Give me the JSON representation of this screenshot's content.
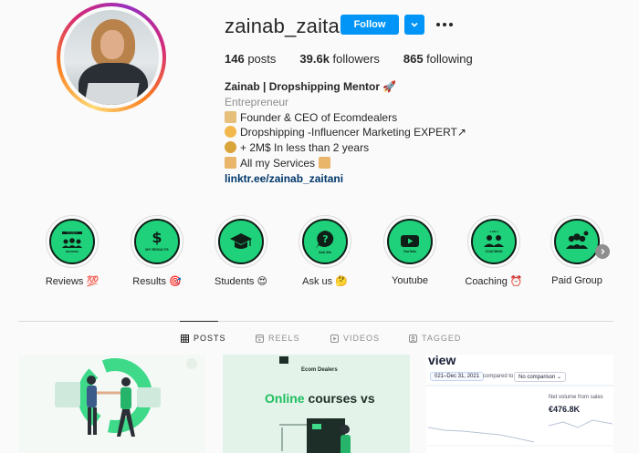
{
  "profile": {
    "username": "zainab_zaitani",
    "follow_label": "Follow",
    "stats": {
      "posts_count": "146",
      "posts_label": " posts",
      "followers_count": "39.6k",
      "followers_label": " followers",
      "following_count": "865",
      "following_label": " following"
    },
    "bio": {
      "name": "Zainab | Dropshipping Mentor 🚀",
      "category": "Entrepreneur",
      "lines": [
        "Founder & CEO of Ecomdealers",
        "Dropshipping -Influencer Marketing EXPERT↗",
        "+ 2M$ In less than 2 years",
        "All my Services"
      ],
      "link": "linktr.ee/zainab_zaitani"
    }
  },
  "highlights": [
    {
      "label": "Reviews 💯",
      "caption": "STUDENT REVIEWS"
    },
    {
      "label": "Results 🎯",
      "caption": "MY RESULTS"
    },
    {
      "label": "Students 😍",
      "caption": ""
    },
    {
      "label": "Ask us 🤔",
      "caption": "Ask Me"
    },
    {
      "label": "Youtube",
      "caption": "YouTube"
    },
    {
      "label": "Coaching ⏰",
      "caption": "COACHING"
    },
    {
      "label": "Paid Group",
      "caption": ""
    }
  ],
  "tabs": [
    {
      "label": "POSTS",
      "icon": "grid-icon",
      "active": true
    },
    {
      "label": "REELS",
      "icon": "reels-icon",
      "active": false
    },
    {
      "label": "VIDEOS",
      "icon": "video-icon",
      "active": false
    },
    {
      "label": "TAGGED",
      "icon": "tag-icon",
      "active": false
    }
  ],
  "posts": {
    "post2": {
      "logo": "Ecom Dealers",
      "title_green": "Online",
      "title_rest": " courses vs"
    },
    "post3": {
      "title": "view",
      "date_range": "021–Dec 31, 2021",
      "compared_to": "compared to",
      "comparison": "No comparison ⌄",
      "net_volume_label": "Net volume from sales",
      "net_volume_value": "€476.8K"
    }
  },
  "colors": {
    "accent": "#0095f6",
    "highlight_green": "#1fd17a",
    "link": "#00376b"
  }
}
